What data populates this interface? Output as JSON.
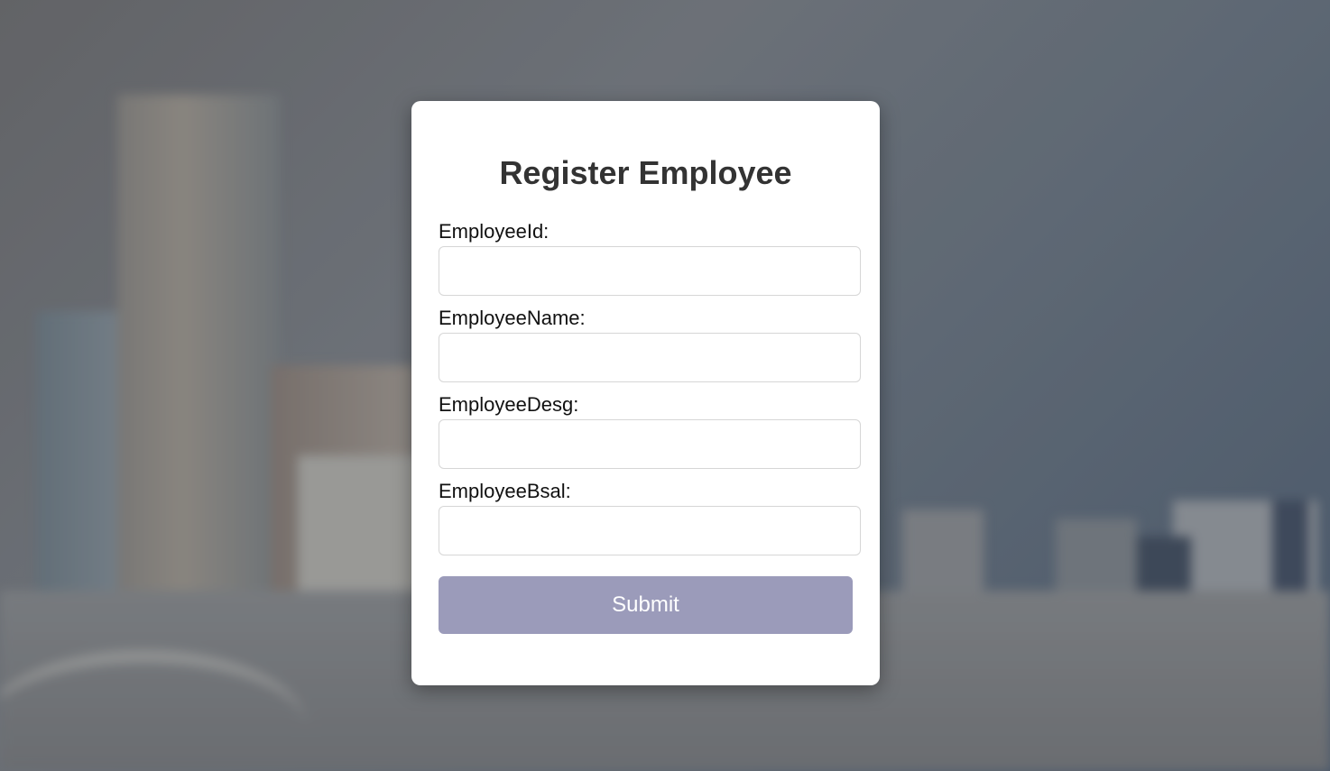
{
  "form": {
    "title": "Register Employee",
    "fields": [
      {
        "label": "EmployeeId:",
        "value": "",
        "placeholder": ""
      },
      {
        "label": "EmployeeName:",
        "value": "",
        "placeholder": ""
      },
      {
        "label": "EmployeeDesg:",
        "value": "",
        "placeholder": ""
      },
      {
        "label": "EmployeeBsal:",
        "value": "",
        "placeholder": ""
      }
    ],
    "submit_label": "Submit"
  },
  "colors": {
    "card_background": "#ffffff",
    "title_text": "#333333",
    "submit_button": "#9b9bba",
    "input_border": "#d6d6d6"
  },
  "icons": {
    "background": "blurred-city-skyline-image"
  }
}
